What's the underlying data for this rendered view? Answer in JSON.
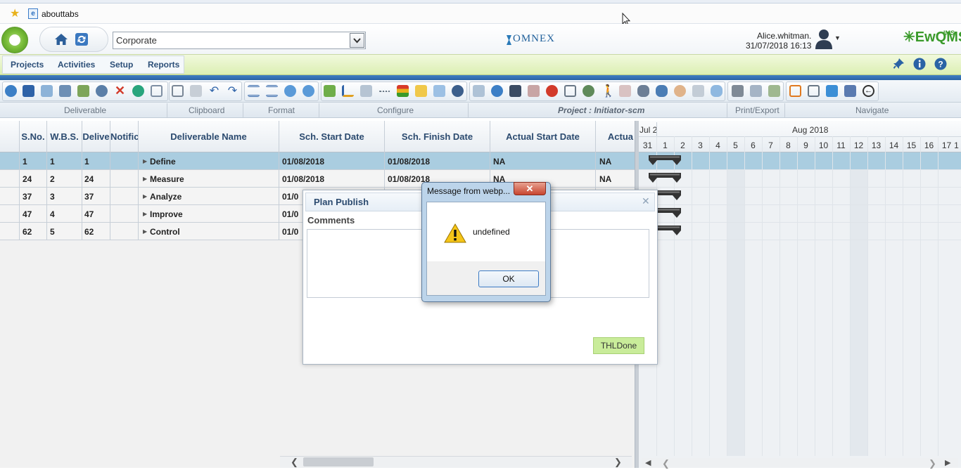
{
  "browser": {
    "favorite_label": "abouttabs"
  },
  "header": {
    "org_select_value": "Corporate",
    "brand_center": "OMNEX",
    "user_name": "Alice.whitman.",
    "user_datetime": "31/07/2018 16:13",
    "brand_right": "EwQMS",
    "brand_right_sup": "IMS"
  },
  "menu": {
    "items": [
      "Projects",
      "Activities",
      "Setup",
      "Reports"
    ]
  },
  "ribbon": {
    "groups": [
      "Deliverable",
      "Clipboard",
      "Format",
      "Configure",
      "Project : Initiator-scm",
      "Print/Export",
      "Navigate"
    ]
  },
  "grid": {
    "columns": [
      "S.No.",
      "W.B.S.",
      "Delive",
      "Notific",
      "Deliverable Name",
      "Sch. Start Date",
      "Sch. Finish Date",
      "Actual Start Date",
      "Actua"
    ],
    "rows": [
      {
        "sno": "1",
        "wbs": "1",
        "deliv": "1",
        "name": "Define",
        "start": "01/08/2018",
        "finish": "01/08/2018",
        "astart": "NA",
        "aend": "NA"
      },
      {
        "sno": "24",
        "wbs": "2",
        "deliv": "24",
        "name": "Measure",
        "start": "01/08/2018",
        "finish": "01/08/2018",
        "astart": "NA",
        "aend": "NA"
      },
      {
        "sno": "37",
        "wbs": "3",
        "deliv": "37",
        "name": "Analyze",
        "start": "01/0",
        "finish": "",
        "astart": "",
        "aend": ""
      },
      {
        "sno": "47",
        "wbs": "4",
        "deliv": "47",
        "name": "Improve",
        "start": "01/0",
        "finish": "",
        "astart": "",
        "aend": ""
      },
      {
        "sno": "62",
        "wbs": "5",
        "deliv": "62",
        "name": "Control",
        "start": "01/0",
        "finish": "",
        "astart": "",
        "aend": ""
      }
    ]
  },
  "gantt": {
    "month_prev": "Jul 2",
    "month": "Aug 2018",
    "days": [
      "31",
      "1",
      "2",
      "3",
      "4",
      "5",
      "6",
      "7",
      "8",
      "9",
      "10",
      "11",
      "12",
      "13",
      "14",
      "15",
      "16",
      "17",
      "1"
    ]
  },
  "plan_dialog": {
    "title": "Plan Publish",
    "comments_label": "Comments",
    "done_button": "THLDone"
  },
  "alert": {
    "title": "Message from webp...",
    "message": "undefined",
    "ok_label": "OK"
  }
}
